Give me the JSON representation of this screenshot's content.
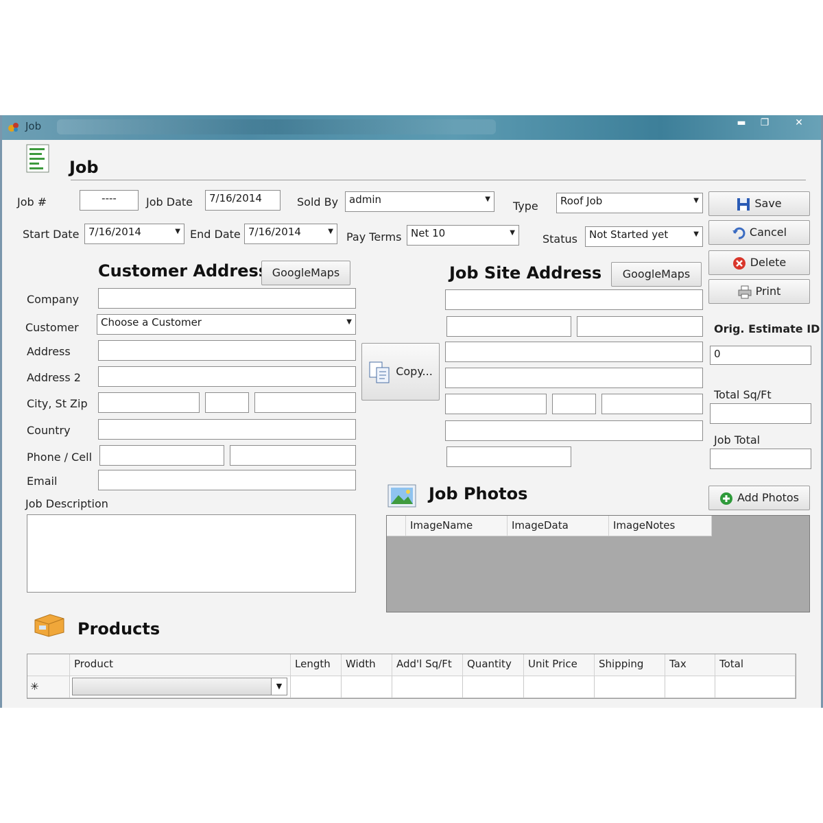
{
  "window": {
    "title": "Job",
    "min_glyph": "▬",
    "max_glyph": "❐",
    "close_glyph": "✕"
  },
  "header": {
    "title": "Job"
  },
  "fields": {
    "job_no_label": "Job #",
    "job_no_value": "----",
    "job_date_label": "Job Date",
    "job_date_value": "7/16/2014",
    "sold_by_label": "Sold By",
    "sold_by_value": "admin",
    "type_label": "Type",
    "type_value": "Roof Job",
    "start_date_label": "Start Date",
    "start_date_value": "7/16/2014",
    "end_date_label": "End Date",
    "end_date_value": "7/16/2014",
    "pay_terms_label": "Pay Terms",
    "pay_terms_value": "Net 10",
    "status_label": "Status",
    "status_value": "Not Started yet"
  },
  "actions": {
    "save": "Save",
    "cancel": "Cancel",
    "delete": "Delete",
    "print": "Print"
  },
  "customer": {
    "title": "Customer Address",
    "maps_button": "GoogleMaps",
    "company_label": "Company",
    "customer_label": "Customer",
    "customer_value": "Choose a Customer",
    "address_label": "Address",
    "address2_label": "Address  2",
    "city_label": "City, St Zip",
    "country_label": "Country",
    "phone_label": "Phone / Cell",
    "email_label": "Email",
    "description_label": "Job Description"
  },
  "copy_button": "Copy...",
  "jobsite": {
    "title": "Job Site Address",
    "maps_button": "GoogleMaps"
  },
  "summary": {
    "estimate_label": "Orig. Estimate ID",
    "estimate_value": "0",
    "sqft_label": "Total Sq/Ft",
    "total_label": "Job Total"
  },
  "photos": {
    "title": "Job Photos",
    "add_button": "Add Photos",
    "columns": [
      "ImageName",
      "ImageData",
      "ImageNotes"
    ]
  },
  "products": {
    "title": "Products",
    "columns": [
      "Product",
      "Length",
      "Width",
      "Add'l Sq/Ft",
      "Quantity",
      "Unit Price",
      "Shipping",
      "Tax",
      "Total"
    ],
    "new_row_marker": "✳"
  },
  "colors": {
    "titlebar": "#4d8aa4",
    "grid_bg": "#a9a9a9",
    "window_bg": "#f3f3f3"
  }
}
